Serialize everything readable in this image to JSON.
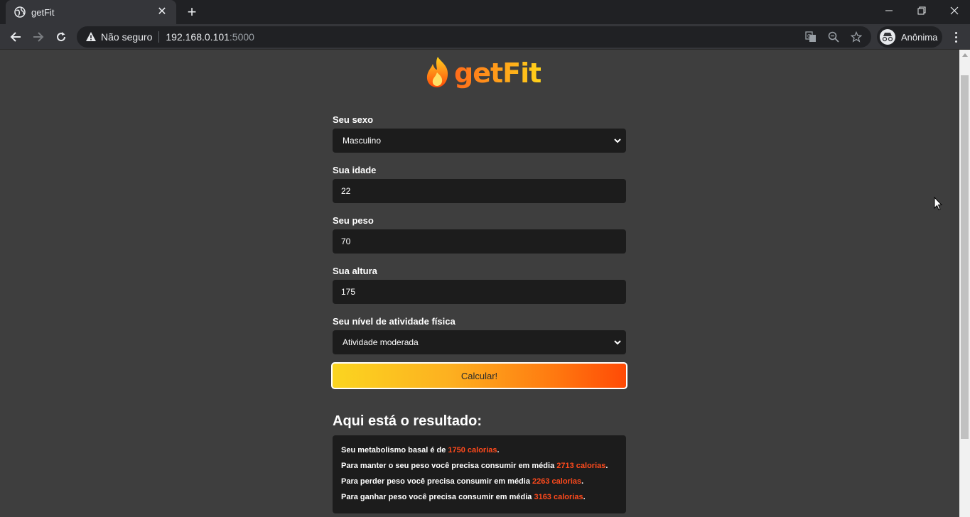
{
  "browser": {
    "tab_title": "getFit",
    "security_text": "Não seguro",
    "url_host": "192.168.0.101",
    "url_port": ":5000",
    "profile_name": "Anônima"
  },
  "page": {
    "logo_text": "getFit",
    "form": {
      "sex_label": "Seu sexo",
      "sex_value": "Masculino",
      "age_label": "Sua idade",
      "age_value": "22",
      "weight_label": "Seu peso",
      "weight_value": "70",
      "height_label": "Sua altura",
      "height_value": "175",
      "activity_label": "Seu nível de atividade física",
      "activity_value": "Atividade moderada"
    },
    "calculate_button": "Calcular!",
    "result": {
      "title": "Aqui está o resultado:",
      "lines": [
        {
          "prefix": "Seu metabolismo basal é de ",
          "value": "1750 calorias",
          "suffix": "."
        },
        {
          "prefix": "Para manter o seu peso você precisa consumir em média ",
          "value": "2713 calorias",
          "suffix": "."
        },
        {
          "prefix": "Para perder peso você precisa consumir em média ",
          "value": "2263 calorias",
          "suffix": "."
        },
        {
          "prefix": "Para ganhar peso você precisa consumir em média ",
          "value": "3163 calorias",
          "suffix": "."
        }
      ]
    }
  },
  "colors": {
    "highlight": "#ff4a1c",
    "field_bg": "#1c1c1c",
    "page_bg": "#3e3e3e"
  }
}
